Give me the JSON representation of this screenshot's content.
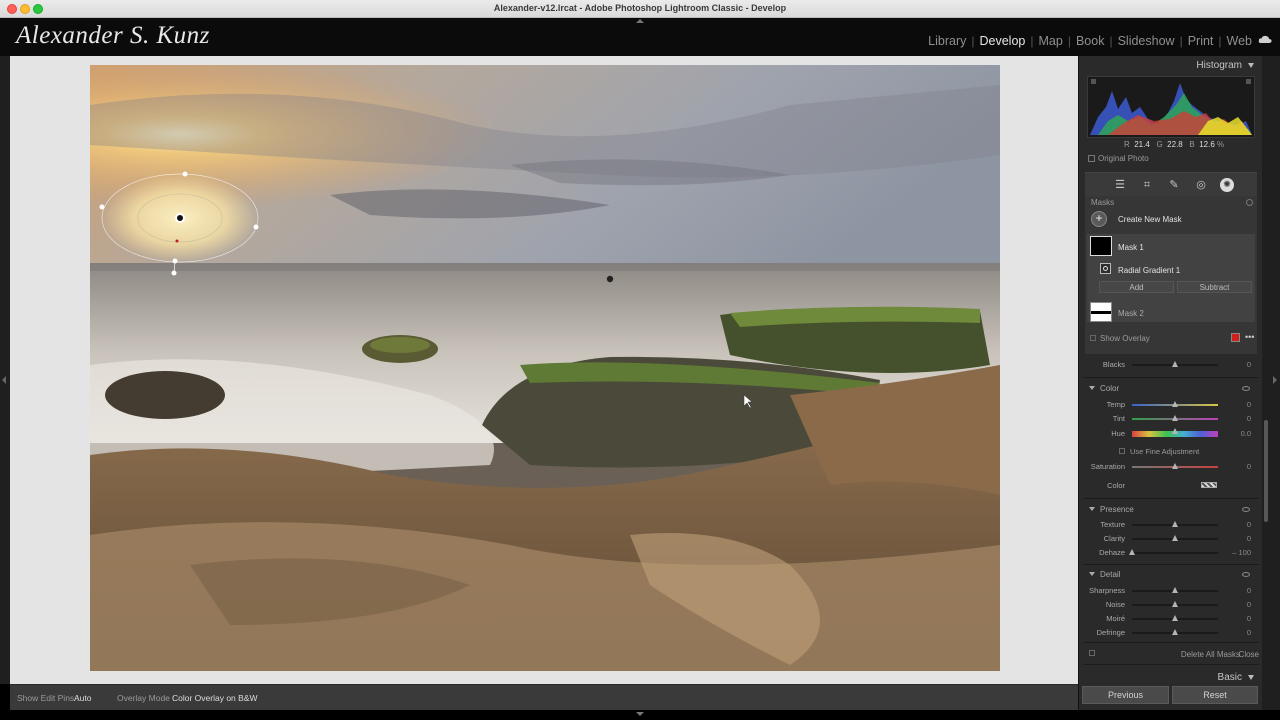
{
  "window": {
    "title": "Alexander-v12.lrcat - Adobe Photoshop Lightroom Classic - Develop"
  },
  "identity_plate": "Alexander S. Kunz",
  "modules": [
    "Library",
    "Develop",
    "Map",
    "Book",
    "Slideshow",
    "Print",
    "Web"
  ],
  "active_module": "Develop",
  "histogram": {
    "title": "Histogram",
    "r_label": "R",
    "r": "21.4",
    "g_label": "G",
    "g": "22.8",
    "b_label": "B",
    "b": "12.6",
    "percent": "%",
    "original_photo": "Original Photo"
  },
  "masks": {
    "title": "Masks",
    "create_new": "Create New Mask",
    "mask1": "Mask 1",
    "radial": "Radial Gradient 1",
    "add": "Add",
    "subtract": "Subtract",
    "mask2": "Mask 2",
    "show_overlay": "Show Overlay",
    "overlay_color": "#d0201e"
  },
  "blacks": {
    "label": "Blacks",
    "value": "0",
    "pos": 0.5
  },
  "color_section": {
    "title": "Color",
    "sliders": [
      {
        "label": "Temp",
        "value": "0",
        "pos": 0.5
      },
      {
        "label": "Tint",
        "value": "0",
        "pos": 0.5
      },
      {
        "label": "Hue",
        "value": "0.0",
        "pos": 0.5
      }
    ],
    "fine_adjust": "Use Fine Adjustment",
    "saturation": {
      "label": "Saturation",
      "value": "0",
      "pos": 0.5
    },
    "color_label": "Color"
  },
  "presence_section": {
    "title": "Presence",
    "sliders": [
      {
        "label": "Texture",
        "value": "0",
        "pos": 0.5
      },
      {
        "label": "Clarity",
        "value": "0",
        "pos": 0.5
      },
      {
        "label": "Dehaze",
        "value": "– 100",
        "pos": 0.0
      }
    ]
  },
  "detail_section": {
    "title": "Detail",
    "sliders": [
      {
        "label": "Sharpness",
        "value": "0",
        "pos": 0.5
      },
      {
        "label": "Noise",
        "value": "0",
        "pos": 0.5
      },
      {
        "label": "Moiré",
        "value": "0",
        "pos": 0.5
      },
      {
        "label": "Defringe",
        "value": "0",
        "pos": 0.5
      }
    ]
  },
  "mask_footer": {
    "delete_all": "Delete All Masks",
    "close": "Close"
  },
  "basic_title": "Basic",
  "footer": {
    "previous": "Previous",
    "reset": "Reset"
  },
  "toolbar": {
    "show_pins_label": "Show Edit Pins :",
    "show_pins_value": "Auto",
    "overlay_label": "Overlay Mode :",
    "overlay_value": "Color Overlay on B&W"
  },
  "colors": {
    "panel_bg": "#2a2a2a",
    "canvas_bg": "#e4e4e4",
    "accent": "#ffffff"
  }
}
